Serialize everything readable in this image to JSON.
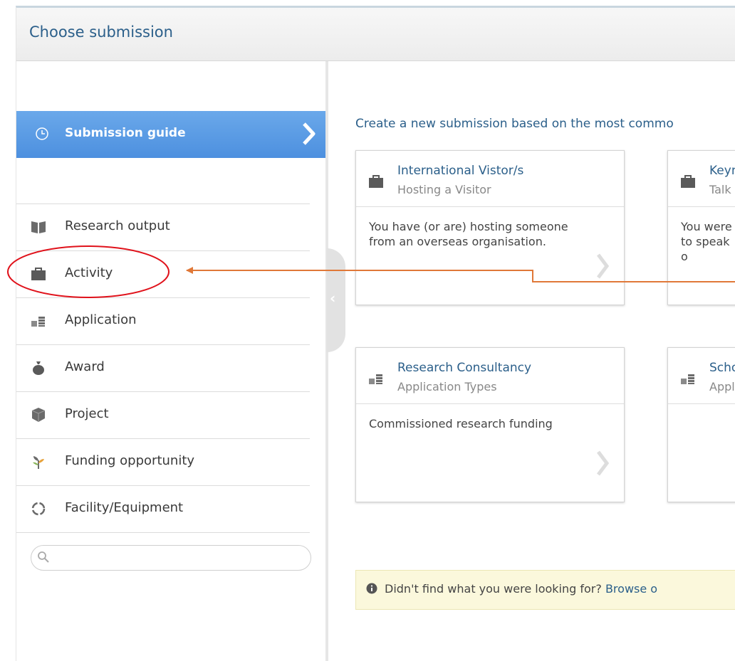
{
  "header": {
    "title": "Choose submission"
  },
  "sidebar": {
    "guide": {
      "label": "Submission guide"
    },
    "items": [
      {
        "label": "Research output",
        "icon": "book-icon"
      },
      {
        "label": "Activity",
        "icon": "briefcase-icon"
      },
      {
        "label": "Application",
        "icon": "coins-icon"
      },
      {
        "label": "Award",
        "icon": "money-bag-icon"
      },
      {
        "label": "Project",
        "icon": "cube-icon"
      },
      {
        "label": "Funding opportunity",
        "icon": "sprout-icon"
      },
      {
        "label": "Facility/Equipment",
        "icon": "ring-icon"
      }
    ],
    "search": {
      "value": "",
      "placeholder": ""
    }
  },
  "main": {
    "intro": "Create a new submission based on the most commo",
    "cards": [
      {
        "title": "International Vistor/s",
        "subtitle": "Hosting a Visitor",
        "description": "You have (or are) hosting someone from an overseas organisation.",
        "icon": "briefcase-icon"
      },
      {
        "title": "Keyno",
        "subtitle": "Talk o",
        "description": "You were to speak o",
        "icon": "briefcase-icon"
      },
      {
        "title": "Research Consultancy",
        "subtitle": "Application Types",
        "description": "Commissioned research funding",
        "icon": "coins-icon"
      },
      {
        "title": "Schol",
        "subtitle": "Appli",
        "description": "",
        "icon": "coins-icon"
      }
    ],
    "notice": {
      "text": "Didn't find what you were looking for?",
      "link": "Browse o"
    }
  },
  "colors": {
    "accent": "#4d90df",
    "link": "#2b5f8a",
    "annotation": "#e0121b",
    "arrow": "#e07838",
    "notice_bg": "#fbf8dc"
  }
}
